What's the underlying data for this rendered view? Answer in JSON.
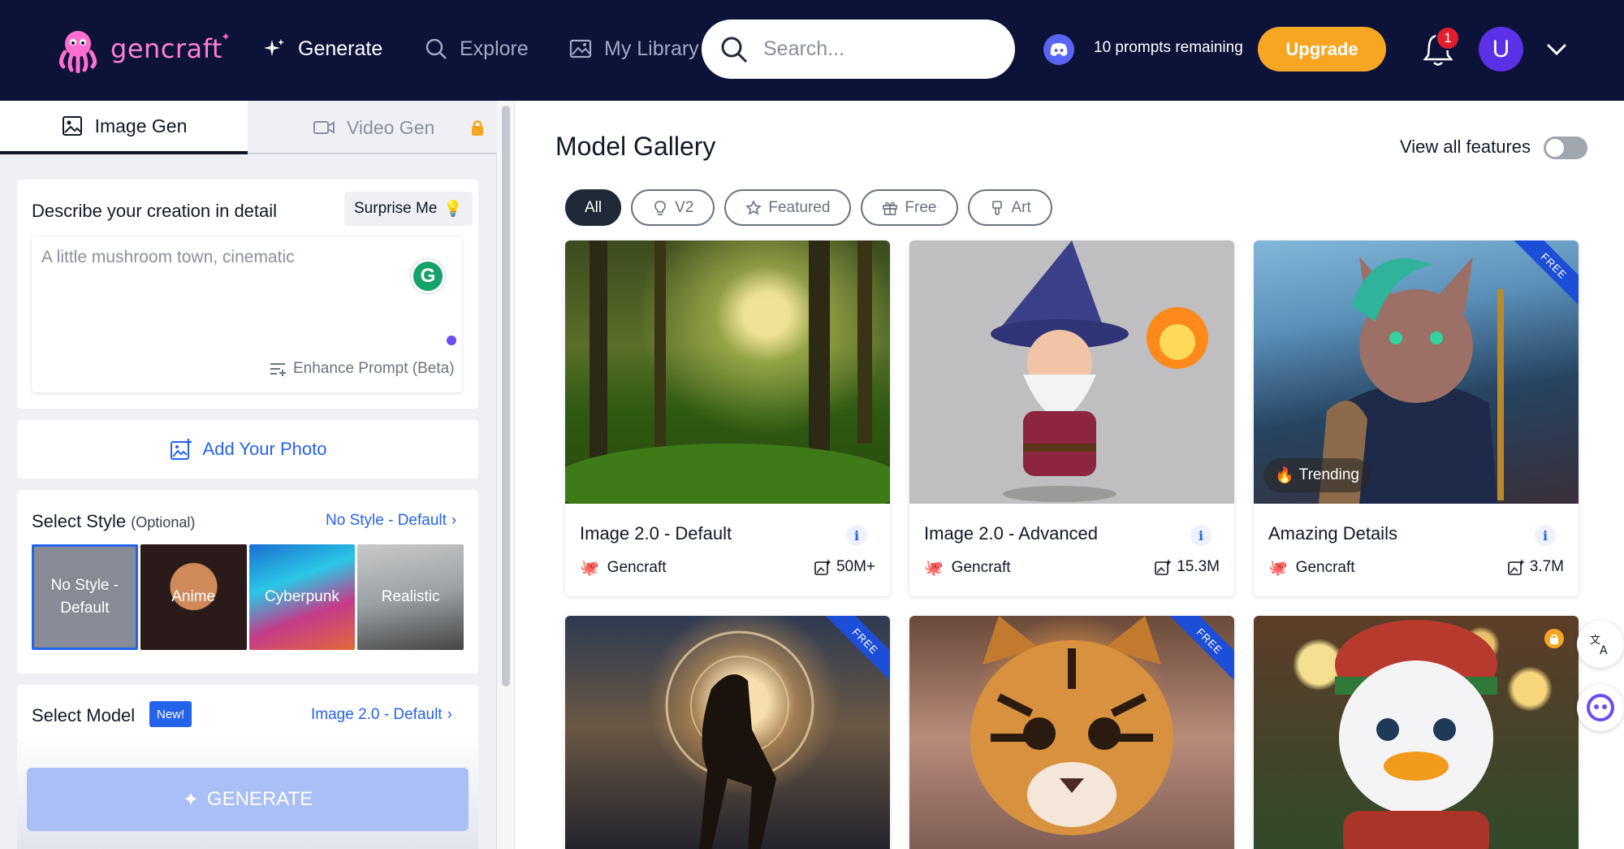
{
  "nav": {
    "brand": "gencraft",
    "items": [
      {
        "label": "Generate",
        "icon": "sparkles-icon"
      },
      {
        "label": "Explore",
        "icon": "search-icon"
      },
      {
        "label": "My Library",
        "icon": "image-library-icon"
      }
    ],
    "search_placeholder": "Search...",
    "prompts_remaining": "10 prompts remaining",
    "upgrade_label": "Upgrade",
    "notification_count": "1",
    "avatar_initial": "U"
  },
  "left": {
    "tabs": [
      {
        "label": "Image Gen",
        "active": true
      },
      {
        "label": "Video Gen",
        "active": false,
        "locked": true
      }
    ],
    "describe": {
      "label": "Describe your creation in detail",
      "surprise_label": "Surprise Me",
      "prompt_placeholder": "A little mushroom town, cinematic",
      "enhance_label": "Enhance Prompt (Beta)"
    },
    "add_photo_label": "Add Your Photo",
    "style": {
      "label": "Select Style",
      "optional": "(Optional)",
      "current": "No Style - Default",
      "options": [
        "No Style - Default",
        "Anime",
        "Cyberpunk",
        "Realistic"
      ]
    },
    "model": {
      "label": "Select Model",
      "badge": "New!",
      "current": "Image 2.0 - Default"
    },
    "generate_label": "GENERATE"
  },
  "gallery": {
    "title": "Model Gallery",
    "view_all_label": "View all features",
    "view_all_on": false,
    "filters": [
      {
        "label": "All",
        "active": true
      },
      {
        "label": "V2",
        "icon": "lightbulb-icon"
      },
      {
        "label": "Featured",
        "icon": "star-icon"
      },
      {
        "label": "Free",
        "icon": "gift-icon"
      },
      {
        "label": "Art",
        "icon": "brush-icon"
      }
    ],
    "cards": [
      {
        "name": "Image 2.0 - Default",
        "author": "Gencraft",
        "count": "50M+",
        "free": false
      },
      {
        "name": "Image 2.0 - Advanced",
        "author": "Gencraft",
        "count": "15.3M",
        "free": false
      },
      {
        "name": "Amazing Details",
        "author": "Gencraft",
        "count": "3.7M",
        "free": true,
        "trending": "Trending"
      },
      {
        "free": true
      },
      {
        "free": true
      },
      {
        "locked": true
      }
    ],
    "ribbon_label": "FREE",
    "colors": {
      "accent": "#2563eb",
      "nav_bg": "#0c1238",
      "upgrade": "#f6a623"
    }
  }
}
